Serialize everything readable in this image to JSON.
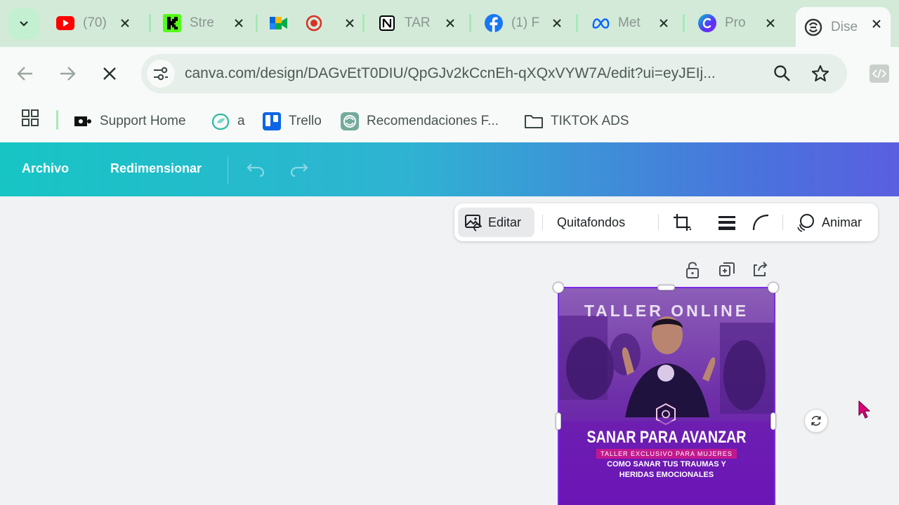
{
  "browser": {
    "tabs": [
      {
        "title": "(70)",
        "icon": "youtube-icon",
        "color": "#ff0000"
      },
      {
        "title": "Stre",
        "icon": "kick-icon",
        "color": "#53fc18"
      },
      {
        "title": "",
        "icon": "google-meet-icon",
        "color": "#00897b"
      },
      {
        "title": "",
        "icon": "record-icon",
        "color": "#d93025"
      },
      {
        "title": "TAR",
        "icon": "notion-icon",
        "color": "#000000"
      },
      {
        "title": "(1) F",
        "icon": "facebook-icon",
        "color": "#1877f2"
      },
      {
        "title": "Met",
        "icon": "meta-icon",
        "color": "#0866ff"
      },
      {
        "title": "Pro",
        "icon": "canva-icon",
        "color": "#00c4cc"
      },
      {
        "title": "Dise",
        "icon": "chatgpt-icon",
        "color": "#444444"
      }
    ],
    "url": "canva.com/design/DAGvEtT0DIU/QpGJv2kCcnEh-qXQxVYW7A/edit?ui=eyJEIj...",
    "bookmarks": [
      {
        "label": "Support Home",
        "icon": "support-icon"
      },
      {
        "label": "a",
        "icon": "ai-leaf-icon"
      },
      {
        "label": "Trello",
        "icon": "trello-icon"
      },
      {
        "label": "Recomendaciones F...",
        "icon": "chatgpt-icon"
      },
      {
        "label": "TIKTOK ADS",
        "icon": "folder-icon"
      }
    ]
  },
  "canva": {
    "menu": {
      "file": "Archivo",
      "resize": "Redimensionar"
    },
    "context_toolbar": {
      "edit": "Editar",
      "bg_remover": "Quitafondos",
      "animate": "Animar"
    },
    "poster": {
      "top_title": "TALLER ONLINE",
      "headline": "SANAR PARA AVANZAR",
      "subtitle": "TALLER EXCLUSIVO PARA MUJERES",
      "tagline_1": "COMO SANAR TUS TRAUMAS Y",
      "tagline_2": "HERIDAS EMOCIONALES"
    }
  },
  "colors": {
    "accent_teal": "#17c5c4",
    "accent_blue": "#5a5fe0",
    "poster_purple": "#7e2fbb",
    "cursor_pink": "#e0007a"
  }
}
